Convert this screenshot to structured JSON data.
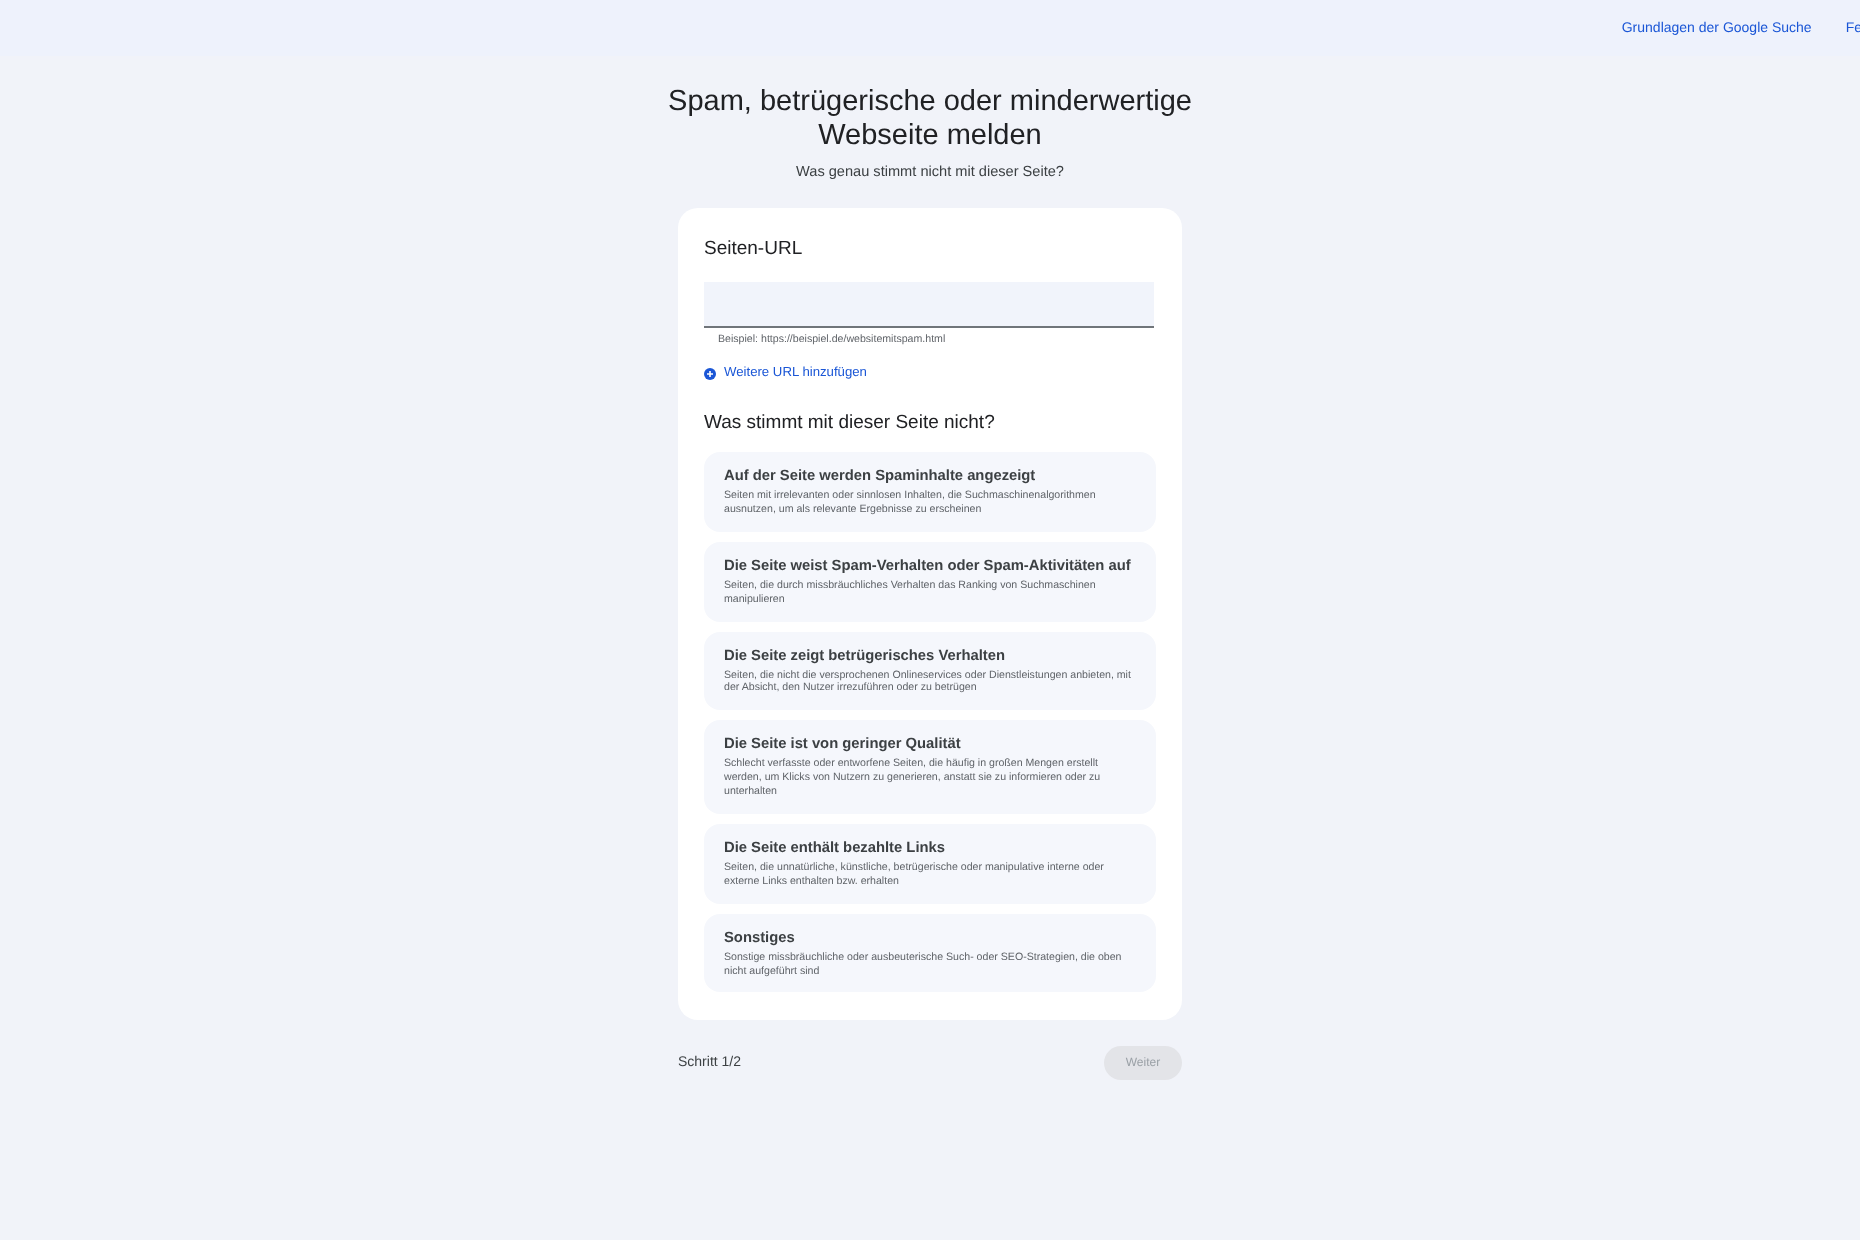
{
  "header": {
    "links": [
      "Grundlagen der Google Suche",
      "Fe"
    ]
  },
  "title": "Spam, betrügerische oder minderwertige Webseite melden",
  "subtitle": "Was genau stimmt nicht mit dieser Seite?",
  "form": {
    "url_label": "Seiten-URL",
    "url_field": {
      "hint": "Beispiel: https://beispiel.de/websitemitspam.html"
    },
    "add_url": "Weitere URL hinzufügen",
    "question": "Was stimmt mit dieser Seite nicht?",
    "options": [
      {
        "title": "Auf der Seite werden Spaminhalte angezeigt",
        "description": "Seiten mit irrelevanten oder sinnlosen Inhalten, die Suchmaschinenalgorithmen ausnutzen, um als relevante Ergebnisse zu erscheinen"
      },
      {
        "title": "Die Seite weist Spam-Verhalten oder Spam-Aktivitäten auf",
        "description": "Seiten, die durch missbräuchliches Verhalten das Ranking von Suchmaschinen manipulieren"
      },
      {
        "title": "Die Seite zeigt betrügerisches Verhalten",
        "description": "Seiten, die nicht die versprochenen Onlineservices oder Dienstleistungen anbieten, mit der Absicht, den Nutzer irrezuführen oder zu betrügen"
      },
      {
        "title": "Die Seite ist von geringer Qualität",
        "description": "Schlecht verfasste oder entworfene Seiten, die häufig in großen Mengen erstellt werden, um Klicks von Nutzern zu generieren, anstatt sie zu informieren oder zu unterhalten"
      },
      {
        "title": "Die Seite enthält bezahlte Links",
        "description": "Seiten, die unnatürliche, künstliche, betrügerische oder manipulative interne oder externe Links enthalten bzw. erhalten"
      },
      {
        "title": "Sonstiges",
        "description": "Sonstige missbräuchliche oder ausbeuterische Such- oder SEO-Strategien, die oben nicht aufgeführt sind"
      }
    ]
  },
  "footer": {
    "step": "Schritt 1/2",
    "next_button": {
      "label": "Weiter",
      "disabled": true
    }
  }
}
